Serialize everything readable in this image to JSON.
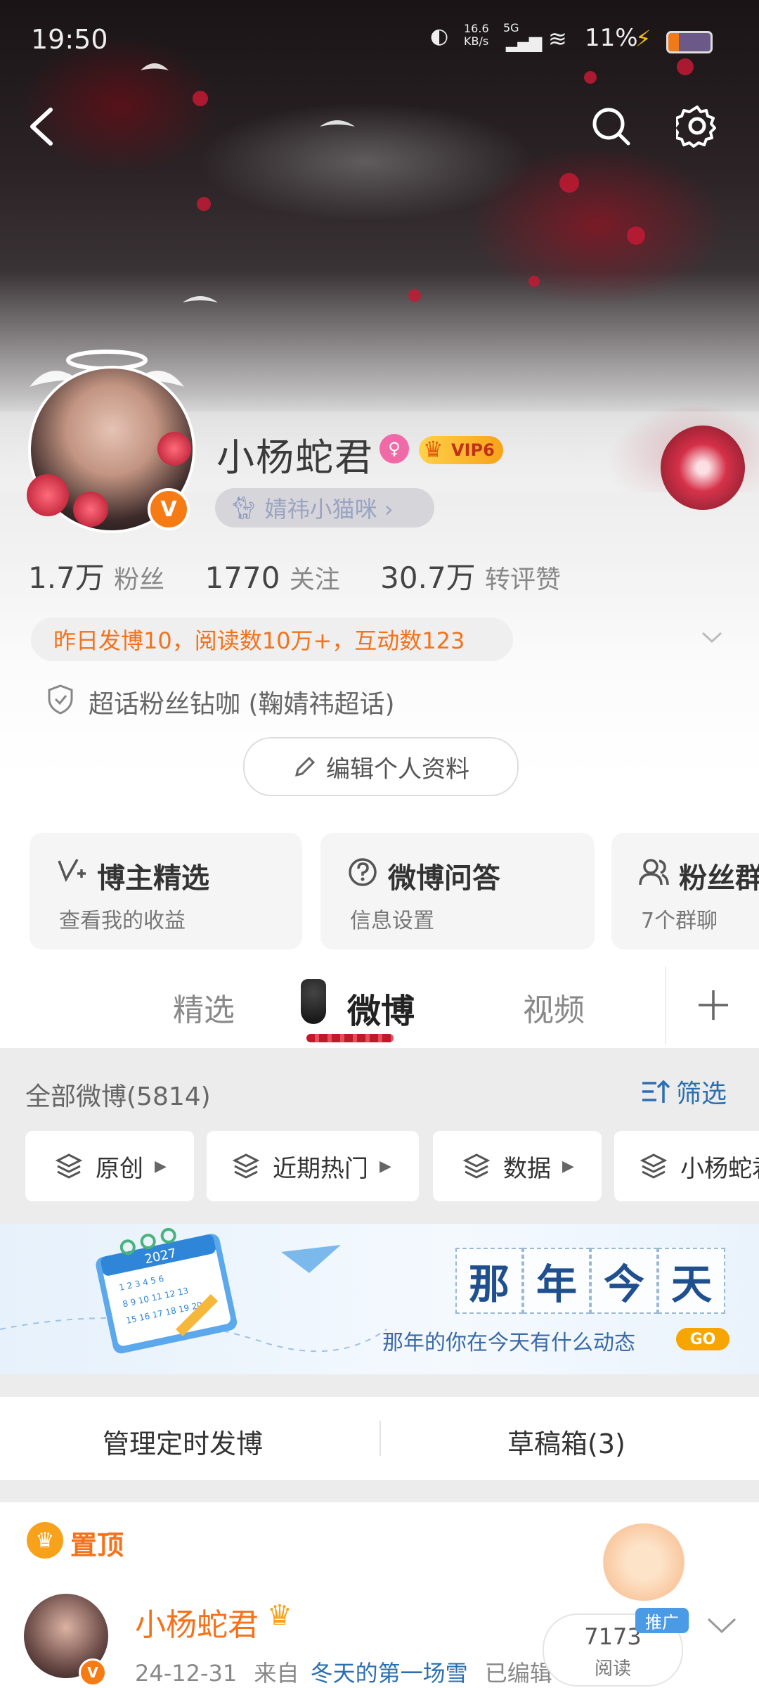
{
  "status_bar": {
    "time": "19:50",
    "net_speed": "16.6",
    "net_unit": "KB/s",
    "net_type": "5G",
    "battery": "11%"
  },
  "profile": {
    "name": "小杨蛇君",
    "vip": "VIP6",
    "nickname_tag": "婧祎小猫咪 ›",
    "stats": [
      {
        "value": "1.7万",
        "label": "粉丝"
      },
      {
        "value": "1770",
        "label": "关注"
      },
      {
        "value": "30.7万",
        "label": "转评赞"
      }
    ],
    "activity": "昨日发博10，阅读数10万+，互动数123",
    "badge_text": "超话粉丝钻咖 (鞠婧祎超话)",
    "edit_button": "编辑个人资料"
  },
  "cards": [
    {
      "title": "博主精选",
      "subtitle": "查看我的收益",
      "icon": "check-plus-icon"
    },
    {
      "title": "微博问答",
      "subtitle": "信息设置",
      "icon": "question-icon"
    },
    {
      "title": "粉丝群",
      "subtitle": "7个群聊",
      "icon": "group-icon"
    }
  ],
  "tabs": [
    "精选",
    "微博",
    "视频"
  ],
  "filter": {
    "all_label": "全部微博(5814)",
    "filter_button": "筛选"
  },
  "chips": [
    "原创",
    "近期热门",
    "数据",
    "小杨蛇君"
  ],
  "banner": {
    "chars": [
      "那",
      "年",
      "今",
      "天"
    ],
    "caption": "那年的你在今天有什么动态",
    "go": "GO",
    "calendar_year": "2027"
  },
  "manage": {
    "scheduled": "管理定时发博",
    "drafts": "草稿箱(3)"
  },
  "pinned": {
    "label": "置顶",
    "author": "小杨蛇君",
    "date": "24-12-31",
    "from_label": "来自",
    "source": "冬天的第一场雪",
    "edited": "已编辑",
    "reads": "7173",
    "reads_label": "阅读",
    "promo": "推广"
  },
  "colors": {
    "accent_orange": "#f3721b",
    "link_blue": "#2c6fb0",
    "tab_red": "#c0192c"
  }
}
